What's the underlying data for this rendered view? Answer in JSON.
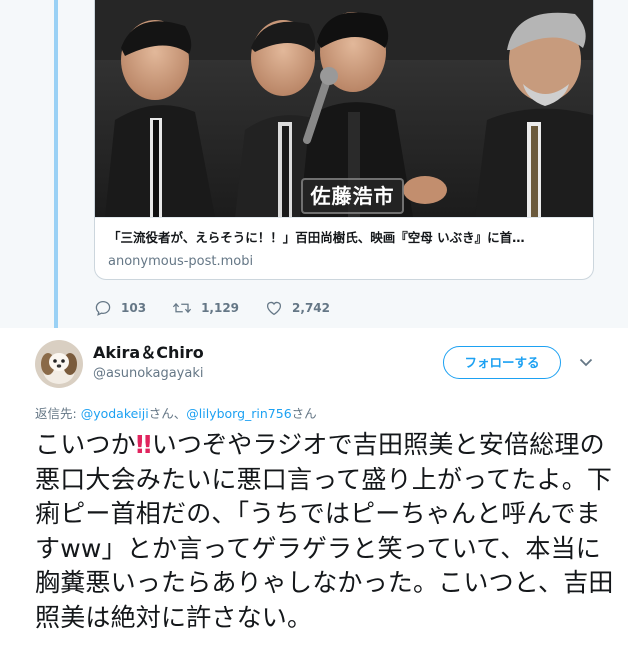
{
  "card": {
    "image_caption": "佐藤浩市",
    "title": "「三流役者が、えらそうに！！」百田尚樹氏、映画『空母 いぶき』に首…",
    "domain": "anonymous-post.mobi"
  },
  "actions": {
    "replies": "103",
    "retweets": "1,129",
    "likes": "2,742"
  },
  "tweet": {
    "name": "Akira＆Chiro",
    "handle": "@asunokagayaki",
    "follow_label": "フォローする",
    "reply_prefix": "返信先: ",
    "reply_user1": "@yodakeiji",
    "reply_mid": "さん、",
    "reply_user2": "@lilyborg_rin756",
    "reply_suffix": "さん",
    "text_before": "こいつか",
    "bang": "‼",
    "text_after": "いつぞやラジオで吉田照美と安倍総理の悪口大会みたいに悪口言って盛り上がってたよ。下痢ピー首相だの、「うちではピーちゃんと呼んでますww」とか言ってゲラゲラと笑っていて、本当に胸糞悪いったらありゃしなかった。こいつと、吉田照美は絶対に許さない。"
  },
  "colors": {
    "accent": "#1da1f2",
    "muted": "#657786",
    "thread_line": "#9ad1f5",
    "alert": "#e0245e"
  },
  "icons": [
    "reply-icon",
    "retweet-icon",
    "like-icon",
    "chevron-down-icon"
  ]
}
